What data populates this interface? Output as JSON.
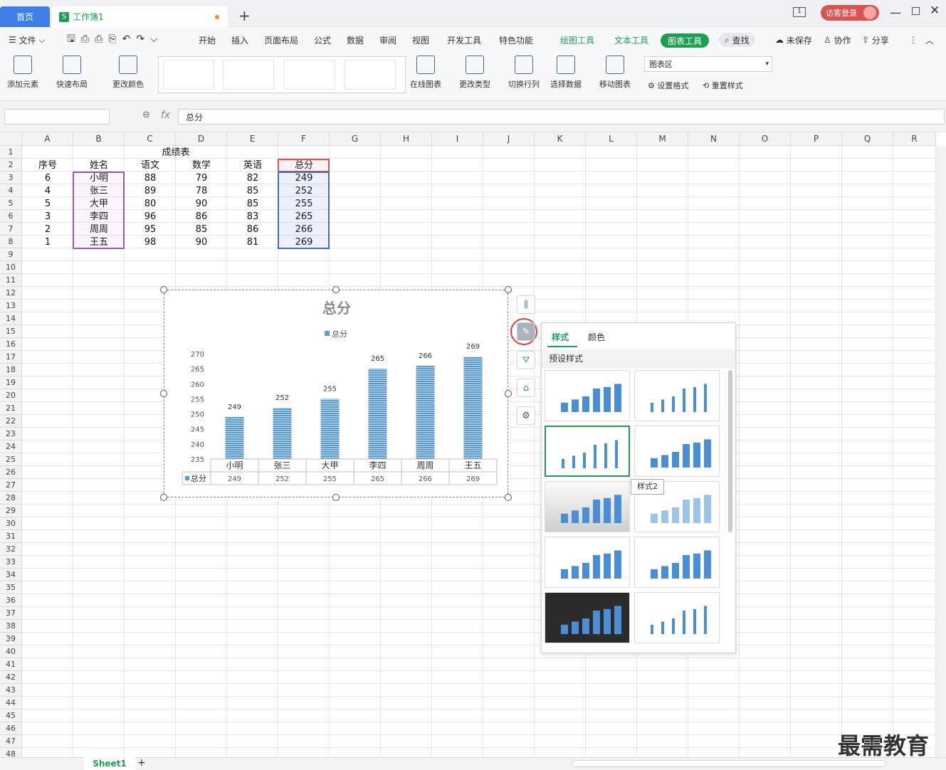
{
  "tabs": {
    "home": "首页",
    "book": "工作簿1"
  },
  "login": "访客登录",
  "menu": {
    "file": "文件",
    "start": "开始",
    "insert": "插入",
    "layout": "页面布局",
    "formula": "公式",
    "data": "数据",
    "review": "审阅",
    "view": "视图",
    "dev": "开发工具",
    "special": "特色功能",
    "draw": "绘图工具",
    "text": "文本工具",
    "chart": "图表工具",
    "find": "查找",
    "unsaved": "未保存",
    "collab": "协作",
    "share": "分享"
  },
  "ribbon": {
    "add_element": "添加元素",
    "quick_layout": "快速布局",
    "change_color": "更改颜色",
    "online_chart": "在线图表",
    "change_type": "更改类型",
    "switch_rowcol": "切换行列",
    "select_data": "选择数据",
    "move_chart": "移动图表",
    "chart_area": "图表区",
    "set_format": "设置格式",
    "reset_style": "重置样式"
  },
  "formula": {
    "fx": "fx",
    "content": "总分"
  },
  "columns": [
    "A",
    "B",
    "C",
    "D",
    "E",
    "F",
    "G",
    "H",
    "I",
    "J",
    "K",
    "L",
    "M",
    "N",
    "O",
    "P",
    "Q",
    "R"
  ],
  "table": {
    "title": "成绩表",
    "headers": [
      "序号",
      "姓名",
      "语文",
      "数学",
      "英语",
      "总分"
    ],
    "rows": [
      [
        "6",
        "小明",
        "88",
        "79",
        "82",
        "249"
      ],
      [
        "4",
        "张三",
        "89",
        "78",
        "85",
        "252"
      ],
      [
        "5",
        "大甲",
        "80",
        "90",
        "85",
        "255"
      ],
      [
        "3",
        "李四",
        "96",
        "86",
        "83",
        "265"
      ],
      [
        "2",
        "周周",
        "95",
        "85",
        "86",
        "266"
      ],
      [
        "1",
        "王五",
        "98",
        "90",
        "81",
        "269"
      ]
    ]
  },
  "chart_data": {
    "type": "bar",
    "title": "总分",
    "legend": "总分",
    "categories": [
      "小明",
      "张三",
      "大甲",
      "李四",
      "周周",
      "王五"
    ],
    "values": [
      249,
      252,
      255,
      265,
      266,
      269
    ],
    "yticks": [
      "270",
      "265",
      "260",
      "255",
      "250",
      "245",
      "240",
      "235"
    ],
    "ylim": [
      235,
      270
    ],
    "table_label": "总分",
    "data_table": true,
    "color": "#5b9bd5"
  },
  "panel": {
    "tab_style": "样式",
    "tab_color": "颜色",
    "section": "预设样式",
    "tooltip": "样式2"
  },
  "sheet": "Sheet1",
  "watermark": "最需教育"
}
